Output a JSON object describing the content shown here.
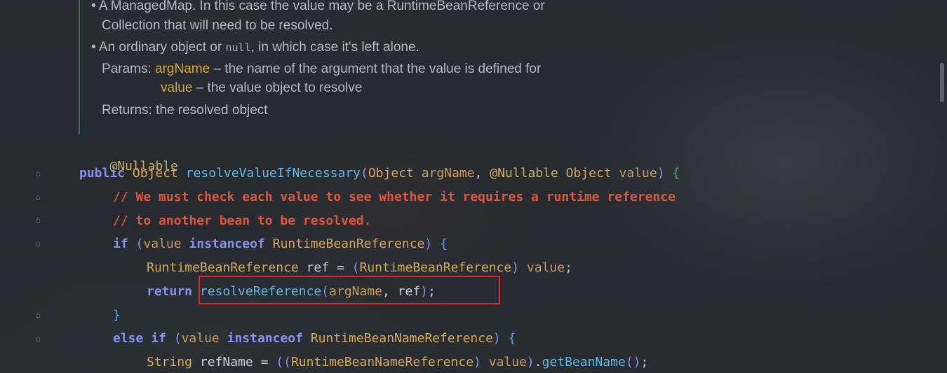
{
  "doc": {
    "bullet1_line1": "A ManagedMap. In this case the value may be a RuntimeBeanReference or",
    "bullet1_line2": "Collection that will need to be resolved.",
    "bullet2_pre": "An ordinary object or ",
    "bullet2_code": "null",
    "bullet2_post": ", in which case it's left alone.",
    "params_label": "Params:",
    "param1_name": "argName",
    "param1_desc": " – the name of the argument that the value is defined for",
    "param2_name": "value",
    "param2_desc": " – the value object to resolve",
    "returns_label": "Returns:",
    "returns_desc": "the resolved object"
  },
  "code": {
    "annotation": "@Nullable",
    "l2_public": "public",
    "l2_type": "Object",
    "l2_method": "resolveValueIfNecessary",
    "l2_open": "(",
    "l2_ptype1": "Object",
    "l2_p1": "argName",
    "l2_comma": ",",
    "l2_ann": "@Nullable",
    "l2_ptype2": "Object",
    "l2_p2": "value",
    "l2_close": ")",
    "l2_brace": "{",
    "comment1": "// We must check each value to see whether it requires a runtime reference",
    "comment2": "// to another bean to be resolved.",
    "l5_if": "if",
    "l5_open": "(",
    "l5_value": "value",
    "l5_instanceof": "instanceof",
    "l5_class": "RuntimeBeanReference",
    "l5_close": ")",
    "l5_brace": "{",
    "l6_type": "RuntimeBeanReference",
    "l6_ref": "ref",
    "l6_eq": "=",
    "l6_cast_open": "(",
    "l6_cast": "RuntimeBeanReference",
    "l6_cast_close": ")",
    "l6_value": "value",
    "l6_semi": ";",
    "l7_return": "return",
    "l7_method": "resolveReference",
    "l7_open": "(",
    "l7_arg1": "argName",
    "l7_comma": ",",
    "l7_arg2": "ref",
    "l7_close": ")",
    "l7_semi": ";",
    "l8_brace": "}",
    "l9_else": "else",
    "l9_if": "if",
    "l9_open": "(",
    "l9_value": "value",
    "l9_instanceof": "instanceof",
    "l9_class": "RuntimeBeanNameReference",
    "l9_close": ")",
    "l9_brace": "{",
    "l10_type": "String",
    "l10_var": "refName",
    "l10_eq": "=",
    "l10_open2": "((",
    "l10_cast": "RuntimeBeanNameReference",
    "l10_cast_close": ")",
    "l10_value": "value",
    "l10_close": ")",
    "l10_dot": ".",
    "l10_method": "getBeanName",
    "l10_call": "()",
    "l10_semi": ";"
  },
  "colors": {
    "keyword": "#8a8ff0",
    "comment": "#e0553b",
    "method": "#5fb6e8",
    "class": "#d5a85a",
    "highlight_box": "#e0252a"
  },
  "icons": {
    "bullet": "•",
    "fold": "fold-marker-icon"
  }
}
